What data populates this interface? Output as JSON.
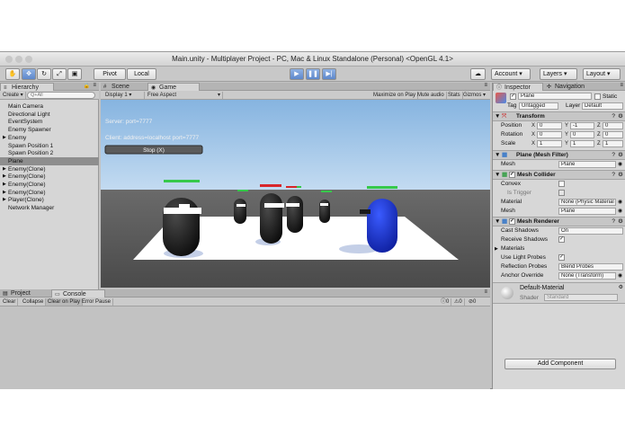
{
  "window": {
    "title": "Main.unity - Multiplayer Project - PC, Mac & Linux Standalone (Personal) <OpenGL 4.1>"
  },
  "toolbar": {
    "pivot_label": "Pivot",
    "local_label": "Local",
    "account_label": "Account",
    "layers_label": "Layers",
    "layout_label": "Layout"
  },
  "hierarchy": {
    "tab": "Hierarchy",
    "create_label": "Create",
    "search_placeholder": "Q+All",
    "items": [
      {
        "label": "Main Camera",
        "arrow": ""
      },
      {
        "label": "Directional Light",
        "arrow": ""
      },
      {
        "label": "EventSystem",
        "arrow": ""
      },
      {
        "label": "Enemy Spawner",
        "arrow": ""
      },
      {
        "label": "Enemy",
        "arrow": "▶"
      },
      {
        "label": "Spawn Position 1",
        "arrow": ""
      },
      {
        "label": "Spawn Position 2",
        "arrow": ""
      },
      {
        "label": "Plane",
        "arrow": "",
        "selected": true
      },
      {
        "label": "Enemy(Clone)",
        "arrow": "▶"
      },
      {
        "label": "Enemy(Clone)",
        "arrow": "▶"
      },
      {
        "label": "Enemy(Clone)",
        "arrow": "▶"
      },
      {
        "label": "Enemy(Clone)",
        "arrow": "▶"
      },
      {
        "label": "Player(Clone)",
        "arrow": "▶"
      },
      {
        "label": "Network Manager",
        "arrow": ""
      }
    ]
  },
  "scene_tabs": {
    "scene": "Scene",
    "game": "Game"
  },
  "game_bar": {
    "display": "Display 1",
    "aspect": "Free Aspect",
    "maximize": "Maximize on Play",
    "mute": "Mute audio",
    "stats": "Stats",
    "gizmos": "Gizmos"
  },
  "game_hud": {
    "server": "Server: port=7777",
    "client": "Client: address=localhost port=7777",
    "stop": "Stop (X)"
  },
  "bottom": {
    "project_tab": "Project",
    "console_tab": "Console",
    "clear": "Clear",
    "collapse": "Collapse",
    "clear_on_play": "Clear on Play",
    "error_pause": "Error Pause",
    "count_info": "0",
    "count_warn": "0",
    "count_error": "0"
  },
  "inspector": {
    "tab": "Inspector",
    "nav_tab": "Navigation",
    "object_name": "Plane",
    "static_label": "Static",
    "tag_label": "Tag",
    "tag_value": "Untagged",
    "layer_label": "Layer",
    "layer_value": "Default",
    "transform": {
      "title": "Transform",
      "position_label": "Position",
      "position": {
        "x": "0",
        "y": "-1",
        "z": "0"
      },
      "rotation_label": "Rotation",
      "rotation": {
        "x": "0",
        "y": "0",
        "z": "0"
      },
      "scale_label": "Scale",
      "scale": {
        "x": "1",
        "y": "1",
        "z": "1"
      }
    },
    "mesh_filter": {
      "title": "Plane (Mesh Filter)",
      "mesh_label": "Mesh",
      "mesh_value": "Plane"
    },
    "mesh_collider": {
      "title": "Mesh Collider",
      "convex_label": "Convex",
      "trigger_label": "Is Trigger",
      "material_label": "Material",
      "material_value": "None (Physic Material",
      "mesh_label": "Mesh",
      "mesh_value": "Plane"
    },
    "mesh_renderer": {
      "title": "Mesh Renderer",
      "cast_label": "Cast Shadows",
      "cast_value": "On",
      "receive_label": "Receive Shadows",
      "materials_label": "Materials",
      "light_probes_label": "Use Light Probes",
      "reflection_label": "Reflection Probes",
      "reflection_value": "Blend Probes",
      "anchor_label": "Anchor Override",
      "anchor_value": "None (Transform)"
    },
    "material": {
      "name": "Default-Material",
      "shader_label": "Shader",
      "shader_value": "Standard"
    },
    "add_component": "Add Component"
  },
  "colors": {
    "play_accent": "#5b87cf",
    "sky": "#9ec3e8",
    "ground": "#ffffff",
    "player": "#1f3bd6",
    "enemy": "#1c1c1c",
    "health_green": "#36c94b",
    "health_red": "#d8262a"
  }
}
